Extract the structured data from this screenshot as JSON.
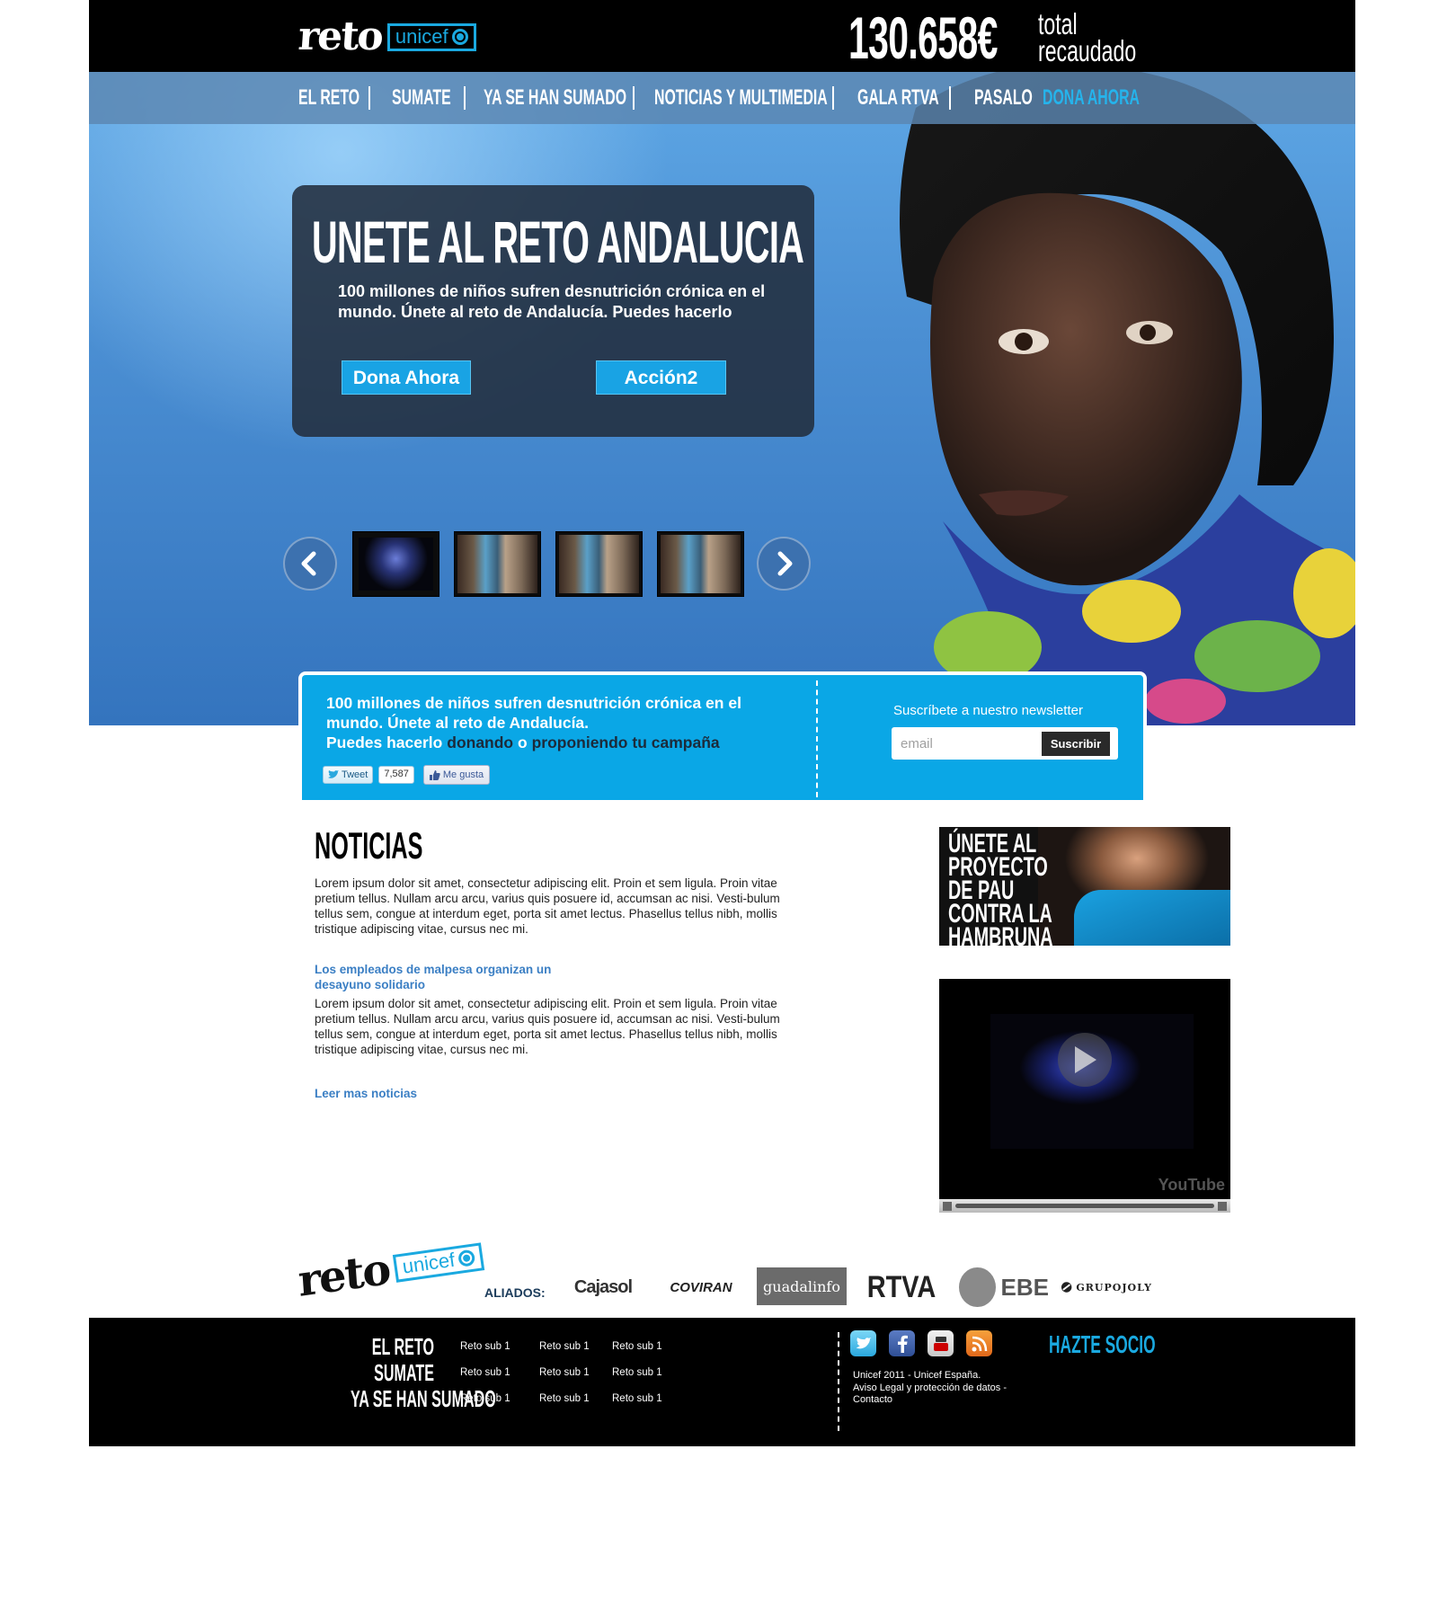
{
  "header": {
    "logo_text": "reto",
    "logo_partner": "unicef",
    "raised_amount": "130.658€",
    "raised_label": "total\nrecaudado"
  },
  "nav": {
    "items": [
      "EL RETO",
      "SUMATE",
      "YA SE HAN SUMADO",
      "NOTICIAS Y MULTIMEDIA",
      "GALA RTVA",
      "PASALO"
    ],
    "donate": "DONA AHORA"
  },
  "hero": {
    "title": "UNETE AL RETO ANDALUCIA",
    "text": "100 millones de niños sufren desnutrición crónica en el mundo. Únete al reto de Andalucía. Puedes hacerlo",
    "button_primary": "Dona Ahora",
    "button_secondary": "Acción2"
  },
  "band": {
    "text_1": "100 millones de niños sufren desnutrición crónica en el mundo. Únete al reto de Andalucía.",
    "text_2": "Puedes hacerlo",
    "link_1": "donando",
    "conj": "o",
    "link_2": "proponiendo tu campaña",
    "tweet_label": "Tweet",
    "tweet_count": "7,587",
    "like_label": "Me gusta",
    "newsletter_label": "Suscríbete a nuestro newsletter",
    "email_placeholder": "email",
    "subscribe_label": "Suscribir"
  },
  "news": {
    "title": "NOTICIAS",
    "intro": "Lorem ipsum dolor sit amet, consectetur adipiscing elit. Proin et sem ligula. Proin vitae pretium tellus. Nullam arcu arcu, varius quis posuere id, accumsan ac nisi. Vesti-bulum tellus sem, congue at interdum eget, porta sit amet lectus. Phasellus tellus nibh, mollis tristique adipiscing vitae, cursus nec mi.",
    "headline": "Los empleados de malpesa organizan un desayuno solidario",
    "body": "Lorem ipsum dolor sit amet, consectetur adipiscing elit. Proin et sem ligula. Proin vitae pretium tellus. Nullam arcu arcu, varius quis posuere id, accumsan ac nisi. Vesti-bulum tellus sem, congue at interdum eget, porta sit amet lectus. Phasellus tellus nibh, mollis tristique adipiscing vitae, cursus nec mi.",
    "more": "Leer mas noticias"
  },
  "promo": {
    "line1": "ÚNETE AL",
    "line2": "PROYECTO",
    "line3": "DE PAU",
    "line4": "CONTRA LA",
    "line5": "HAMBRUNA"
  },
  "video": {
    "brand": "YouTube"
  },
  "sponsors": {
    "label": "ALIADOS:",
    "items": [
      "Cajasol",
      "COVIRAN",
      "guadalinfo",
      "RTVA",
      "EBE",
      "GRUPOJOLY"
    ]
  },
  "footer": {
    "menu": [
      "EL RETO",
      "SUMATE",
      "YA SE  HAN SUMADO"
    ],
    "sub_label": "Reto sub 1",
    "legal_1": "Unicef 2011 - Unicef España.",
    "legal_2": "Aviso Legal y protección de datos -",
    "legal_3": "Contacto",
    "cta": "HAZTE SOCIO"
  },
  "colors": {
    "accent": "#1aa9e0",
    "band": "#0aa7e6",
    "link": "#3b7fc4",
    "topbar": "#000000"
  }
}
